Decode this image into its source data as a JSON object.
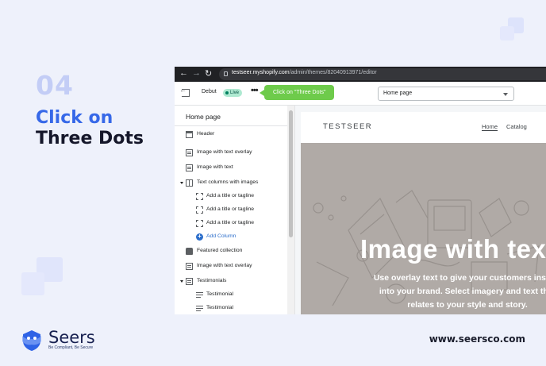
{
  "step": {
    "number": "04",
    "title_line1": "Click on",
    "title_line2": "Three Dots"
  },
  "branding": {
    "name": "Seers",
    "tagline": "Be Compliant, Be Secure",
    "website": "www.seersco.com"
  },
  "colors": {
    "accent_blue": "#3668e8",
    "step_number": "#c3cdf6",
    "callout_green": "#6ecb4b",
    "live_badge": "#aee9d1",
    "hero_bg": "#b0aaa6"
  },
  "browser": {
    "url_host": "testseer.myshopify.com",
    "url_path": "/admin/themes/82040913971/editor",
    "back_icon": "arrow-left",
    "forward_icon": "arrow-right",
    "reload_icon": "reload"
  },
  "editor": {
    "theme_name": "Debut",
    "live_badge": "Live",
    "dots_label": "•••",
    "callout_text": "Click on \"Three Dots\"",
    "page_select": "Home page"
  },
  "sidebar": {
    "title": "Home page",
    "items": [
      {
        "label": "Header",
        "icon": "header-icon"
      },
      {
        "label": "Image with text overlay",
        "icon": "block-icon"
      },
      {
        "label": "Image with text",
        "icon": "block-icon"
      },
      {
        "label": "Text columns with images",
        "icon": "columns-icon",
        "expanded": true
      },
      {
        "label": "Add a title or tagline",
        "icon": "frame-icon"
      },
      {
        "label": "Add a title or tagline",
        "icon": "frame-icon"
      },
      {
        "label": "Add a title or tagline",
        "icon": "frame-icon"
      },
      {
        "label": "Add Column",
        "icon": "plus-circle-icon"
      },
      {
        "label": "Featured collection",
        "icon": "bag-icon"
      },
      {
        "label": "Image with text overlay",
        "icon": "block-icon"
      },
      {
        "label": "Testimonials",
        "icon": "block-icon",
        "expanded": true
      },
      {
        "label": "Testimonial",
        "icon": "lines-icon"
      },
      {
        "label": "Testimonial",
        "icon": "lines-icon"
      }
    ]
  },
  "preview": {
    "store_name": "TESTSEER",
    "nav": [
      "Home",
      "Catalog"
    ],
    "hero_title": "Image with text",
    "hero_subtitle": "Use overlay text to give your customers insight into your brand. Select imagery and text that relates to your style and story."
  }
}
